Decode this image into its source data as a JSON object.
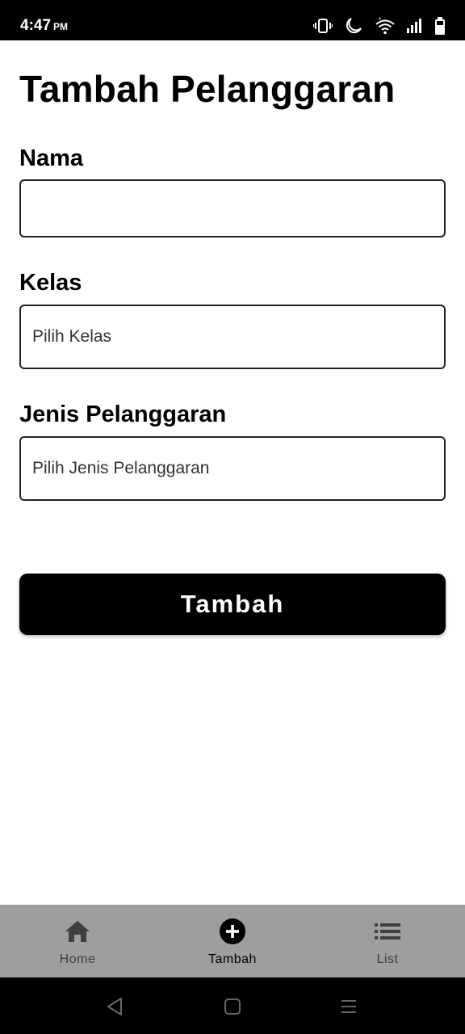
{
  "status_bar": {
    "time": "4:47",
    "ampm": "PM",
    "icons": [
      "vibrate-icon",
      "moon-icon",
      "wifi-icon",
      "signal-icon",
      "battery-icon"
    ]
  },
  "page": {
    "title": "Tambah Pelanggaran"
  },
  "form": {
    "nama": {
      "label": "Nama",
      "value": "",
      "placeholder": ""
    },
    "kelas": {
      "label": "Kelas",
      "selected": "Pilih Kelas"
    },
    "jenis": {
      "label": "Jenis Pelanggaran",
      "selected": "Pilih Jenis Pelanggaran"
    },
    "submit_label": "Tambah"
  },
  "tabs": [
    {
      "label": "Home",
      "icon": "home-icon",
      "active": false
    },
    {
      "label": "Tambah",
      "icon": "add-circle-icon",
      "active": true
    },
    {
      "label": "List",
      "icon": "list-icon",
      "active": false
    }
  ],
  "system_nav": {
    "buttons": [
      "back-icon",
      "home-square-icon",
      "menu-icon"
    ]
  },
  "colors": {
    "primary": "#000000",
    "tab_bar_bg": "#9e9e9e",
    "tab_inactive": "#3f3f3f"
  }
}
